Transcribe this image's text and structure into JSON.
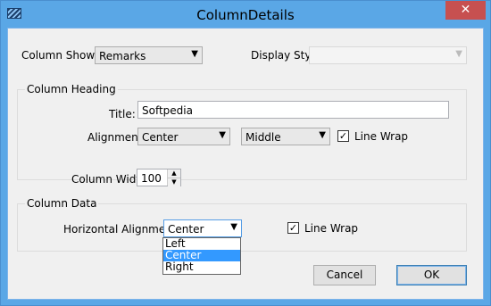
{
  "window": {
    "title": "ColumnDetails",
    "close_glyph": "✕"
  },
  "column_shows": {
    "label": "Column Shows:",
    "value": "Remarks"
  },
  "display_style": {
    "label": "Display Style:",
    "value": ""
  },
  "column_heading": {
    "group_title": "Column Heading",
    "title_label": "Title:",
    "title_value": "Softpedia",
    "alignment_label": "Alignment",
    "horizontal_value": "Center",
    "vertical_value": "Middle",
    "line_wrap_label": "Line Wrap",
    "line_wrap_checked": true
  },
  "column_width": {
    "label": "Column Width:",
    "value": "100"
  },
  "column_data": {
    "group_title": "Column Data",
    "horizontal_label": "Horizontal Alignment:",
    "horizontal_value": "Center",
    "options": [
      "Left",
      "Center",
      "Right"
    ],
    "selected_option": "Center",
    "line_wrap_label": "Line Wrap",
    "line_wrap_checked": true
  },
  "buttons": {
    "cancel": "Cancel",
    "ok": "OK"
  },
  "glyphs": {
    "arrow": "▼",
    "check": "✓",
    "spin_up": "▲",
    "spin_down": "▼"
  }
}
